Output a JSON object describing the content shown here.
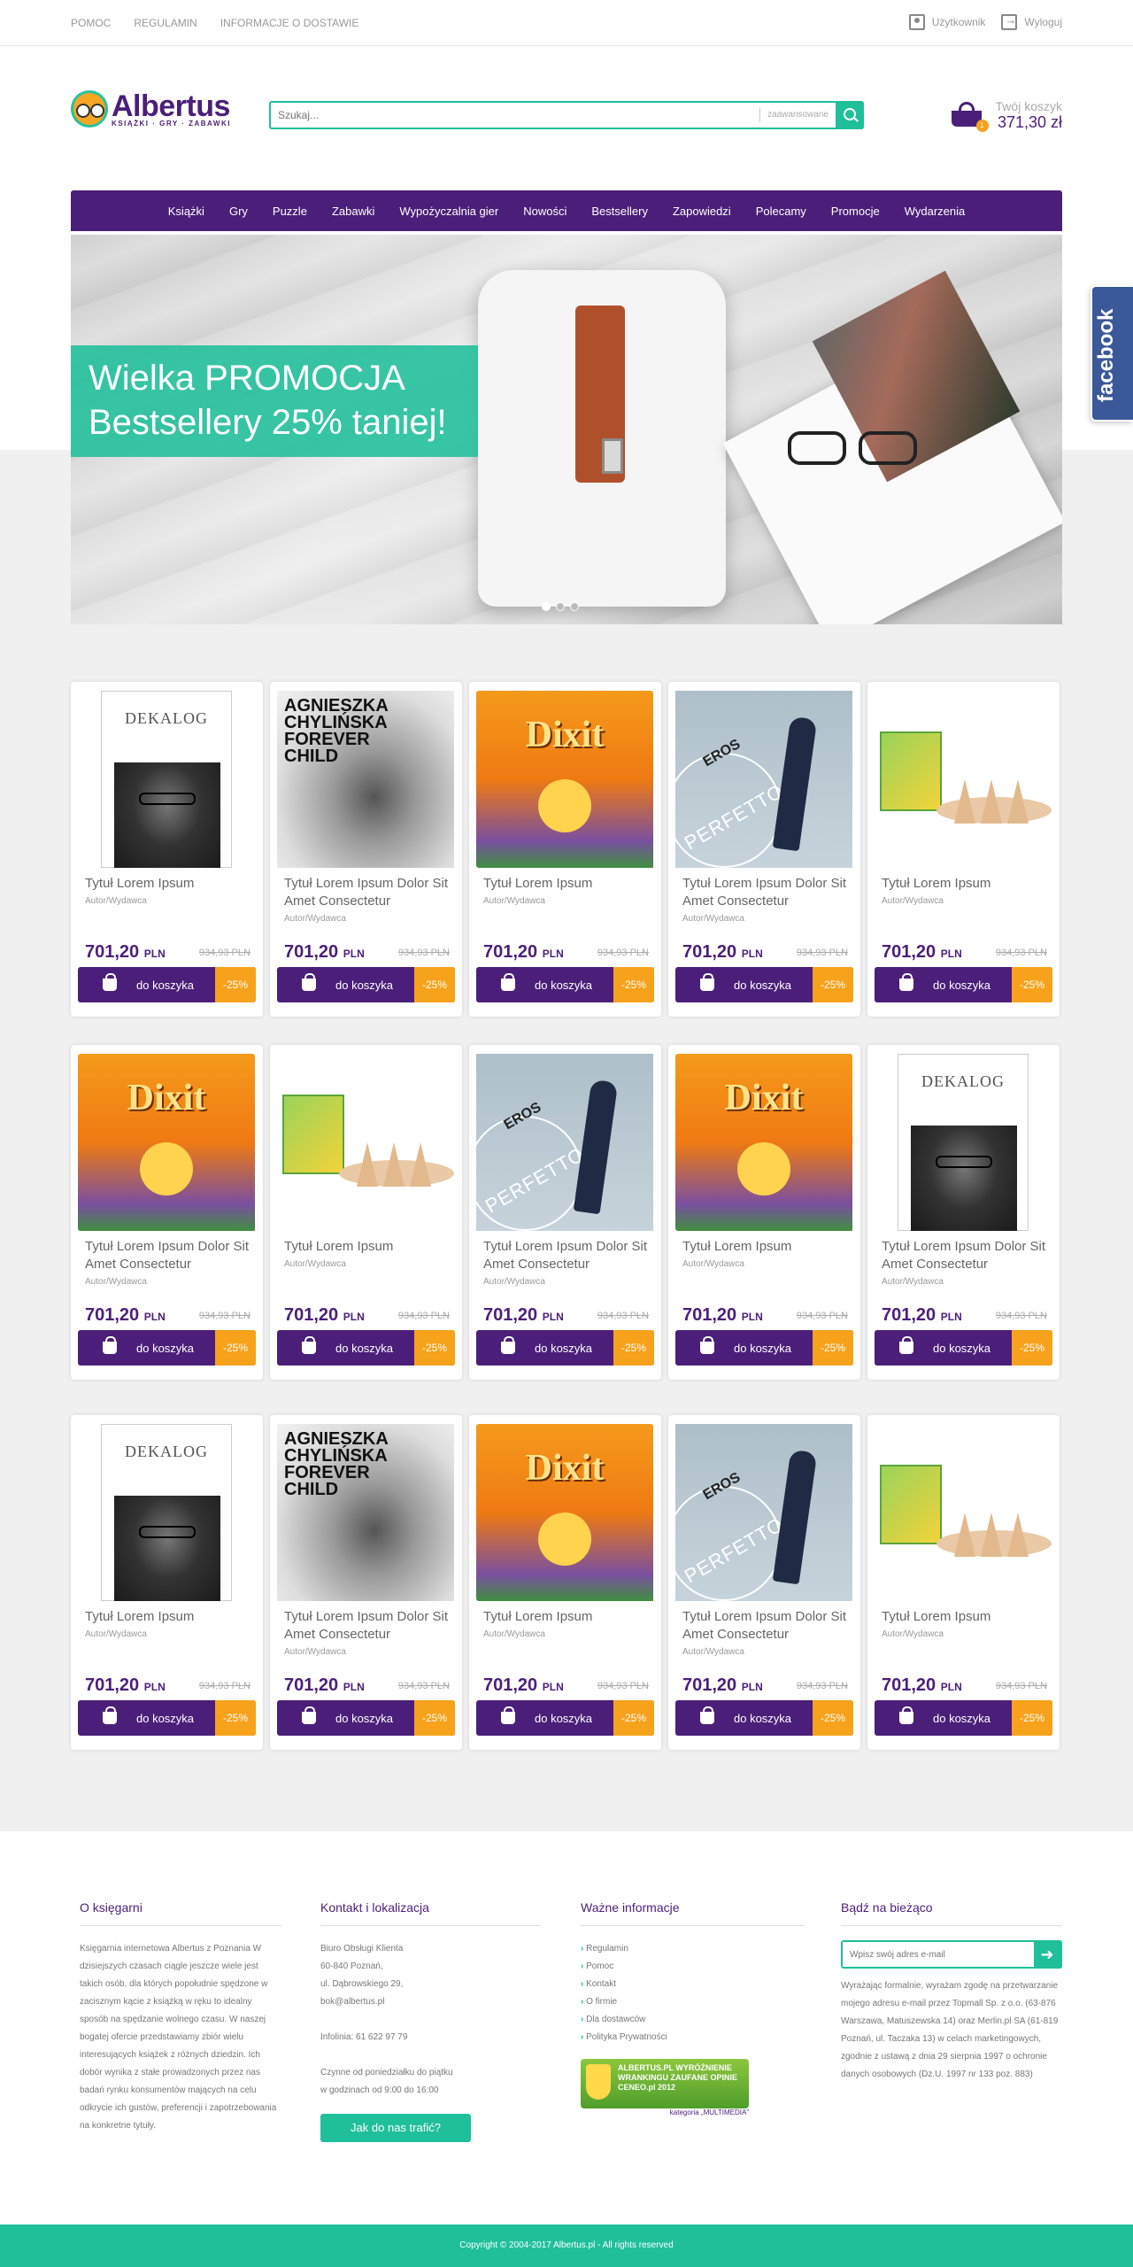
{
  "topbar": {
    "links": [
      "POMOC",
      "REGULAMIN",
      "INFORMACJE O DOSTAWIE"
    ],
    "user_label": "Użytkownik",
    "logout_label": "Wyloguj"
  },
  "logo": {
    "name": "Albertus",
    "tagline": "KSIĄŻKI · GRY · ZABAWKI"
  },
  "search": {
    "placeholder": "Szukaj...",
    "advanced_label": "zaawansowane"
  },
  "cart": {
    "label": "Twój koszyk",
    "total": "371,30 zł",
    "count": "1"
  },
  "nav": {
    "items": [
      "Książki",
      "Gry",
      "Puzzle",
      "Zabawki",
      "Wypożyczalnia gier",
      "Nowości",
      "Bestsellery",
      "Zapowiedzi",
      "Polecamy",
      "Promocje",
      "Wydarzenia"
    ]
  },
  "hero": {
    "line1": "Wielka PROMOCJA",
    "line2": "Bestsellery 25% taniej!",
    "slides": 3,
    "active_slide": 1
  },
  "facebook": {
    "label": "facebook"
  },
  "cover_texts": {
    "dekalog": "DEKALOG",
    "chylinska": "AGNIESZKA CHYLIŃSKA FOREVER CHILD",
    "dixit": "Dixit",
    "eros": "EROS",
    "eros_sub": "PERFETTO"
  },
  "products": {
    "rows": [
      [
        {
          "cover": "dekalog",
          "title": "Tytuł Lorem Ipsum",
          "author": "Autor/Wydawca",
          "price": "701,20",
          "currency": "PLN",
          "old_price": "934,93 PLN",
          "button": "do koszyka",
          "discount": "-25%"
        },
        {
          "cover": "chylinska",
          "title": "Tytuł Lorem Ipsum Dolor Sit Amet Consectetur",
          "author": "Autor/Wydawca",
          "price": "701,20",
          "currency": "PLN",
          "old_price": "934,93 PLN",
          "button": "do koszyka",
          "discount": "-25%"
        },
        {
          "cover": "dixit",
          "title": "Tytuł Lorem Ipsum",
          "author": "Autor/Wydawca",
          "price": "701,20",
          "currency": "PLN",
          "old_price": "934,93 PLN",
          "button": "do koszyka",
          "discount": "-25%"
        },
        {
          "cover": "eros",
          "title": "Tytuł Lorem Ipsum Dolor Sit Amet Consectetur",
          "author": "Autor/Wydawca",
          "price": "701,20",
          "currency": "PLN",
          "old_price": "934,93 PLN",
          "button": "do koszyka",
          "discount": "-25%"
        },
        {
          "cover": "toy",
          "title": "Tytuł Lorem Ipsum",
          "author": "Autor/Wydawca",
          "price": "701,20",
          "currency": "PLN",
          "old_price": "934,93 PLN",
          "button": "do koszyka",
          "discount": "-25%"
        }
      ],
      [
        {
          "cover": "dixit",
          "title": "Tytuł Lorem Ipsum Dolor Sit Amet Consectetur",
          "author": "Autor/Wydawca",
          "price": "701,20",
          "currency": "PLN",
          "old_price": "934,93 PLN",
          "button": "do koszyka",
          "discount": "-25%"
        },
        {
          "cover": "toy",
          "title": "Tytuł Lorem Ipsum",
          "author": "Autor/Wydawca",
          "price": "701,20",
          "currency": "PLN",
          "old_price": "934,93 PLN",
          "button": "do koszyka",
          "discount": "-25%"
        },
        {
          "cover": "eros",
          "title": "Tytuł Lorem Ipsum Dolor Sit Amet Consectetur",
          "author": "Autor/Wydawca",
          "price": "701,20",
          "currency": "PLN",
          "old_price": "934,93 PLN",
          "button": "do koszyka",
          "discount": "-25%"
        },
        {
          "cover": "dixit",
          "title": "Tytuł Lorem Ipsum",
          "author": "Autor/Wydawca",
          "price": "701,20",
          "currency": "PLN",
          "old_price": "934,93 PLN",
          "button": "do koszyka",
          "discount": "-25%"
        },
        {
          "cover": "dekalog",
          "title": "Tytuł Lorem Ipsum Dolor Sit Amet Consectetur",
          "author": "Autor/Wydawca",
          "price": "701,20",
          "currency": "PLN",
          "old_price": "934,93 PLN",
          "button": "do koszyka",
          "discount": "-25%"
        }
      ],
      [
        {
          "cover": "dekalog",
          "title": "Tytuł Lorem Ipsum",
          "author": "Autor/Wydawca",
          "price": "701,20",
          "currency": "PLN",
          "old_price": "934,93 PLN",
          "button": "do koszyka",
          "discount": "-25%"
        },
        {
          "cover": "chylinska",
          "title": "Tytuł Lorem Ipsum Dolor Sit Amet Consectetur",
          "author": "Autor/Wydawca",
          "price": "701,20",
          "currency": "PLN",
          "old_price": "934,93 PLN",
          "button": "do koszyka",
          "discount": "-25%"
        },
        {
          "cover": "dixit",
          "title": "Tytuł Lorem Ipsum",
          "author": "Autor/Wydawca",
          "price": "701,20",
          "currency": "PLN",
          "old_price": "934,93 PLN",
          "button": "do koszyka",
          "discount": "-25%"
        },
        {
          "cover": "eros",
          "title": "Tytuł Lorem Ipsum Dolor Sit Amet Consectetur",
          "author": "Autor/Wydawca",
          "price": "701,20",
          "currency": "PLN",
          "old_price": "934,93 PLN",
          "button": "do koszyka",
          "discount": "-25%"
        },
        {
          "cover": "toy",
          "title": "Tytuł Lorem Ipsum",
          "author": "Autor/Wydawca",
          "price": "701,20",
          "currency": "PLN",
          "old_price": "934,93 PLN",
          "button": "do koszyka",
          "discount": "-25%"
        }
      ]
    ]
  },
  "footer": {
    "about": {
      "title": "O księgarni",
      "text": "Księgarnia internetowa Albertus z Poznania W dzisiejszych czasach ciągle jeszcze wiele jest takich osób, dla których popołudnie spędzone w zacisznym kącie z książką w ręku to idealny sposób na spędzanie wolnego czasu. W naszej bogatej ofercie przedstawiamy zbiór wielu interesujących książek z różnych dziedzin. Ich dobór wynika z stałe prowadzonych przez nas badań rynku konsumentów mających na celu odkrycie ich gustów, preferencji i zapotrzebowania na konkretne tytuły."
    },
    "contact": {
      "title": "Kontakt i lokalizacja",
      "lines": [
        "Biuro Obsługi Klienta",
        "60-840 Poznań,",
        "ul. Dąbrowskiego 29,",
        "bok@albertus.pl",
        "",
        "Infolinia: 61 622 97 79",
        "",
        "Czynne od poniedziałku do piątku",
        "w godzinach od 9:00 do 16:00"
      ],
      "button": "Jak do nas trafić?"
    },
    "info": {
      "title": "Ważne informacje",
      "links": [
        "Regulamin",
        "Pomoc",
        "Kontakt",
        "O firmie",
        "Dla dostawców",
        "Polityka Prywatności"
      ],
      "ceneo_text": "ALBERTUS.PL WYRÓŻNIENIE WRANKINGU ZAUFANE OPINIE CENEO.pl 2012",
      "ceneo_category": "kategoria „MULTIMEDIA”"
    },
    "newsletter": {
      "title": "Bądź na bieżąco",
      "placeholder": "Wpisz swój adres e-mail",
      "note": "Wyrażając formalnie, wyrażam zgodę na przetwarzanie mojego adresu e-mail przez Topmall Sp. z o.o. (63-876 Warszawa, Matuszewska 14) oraz Merlin.pl SA (61-819 Poznań, ul. Taczaka 13) w celach marketingowych, zgodnie z ustawą z dnia 29 sierpnia 1997 o ochronie danych osobowych (Dz.U. 1997 nr 133 poz. 883)"
    }
  },
  "copyright": "Copyright © 2004-2017 Albertus.pl - All rights reserved"
}
